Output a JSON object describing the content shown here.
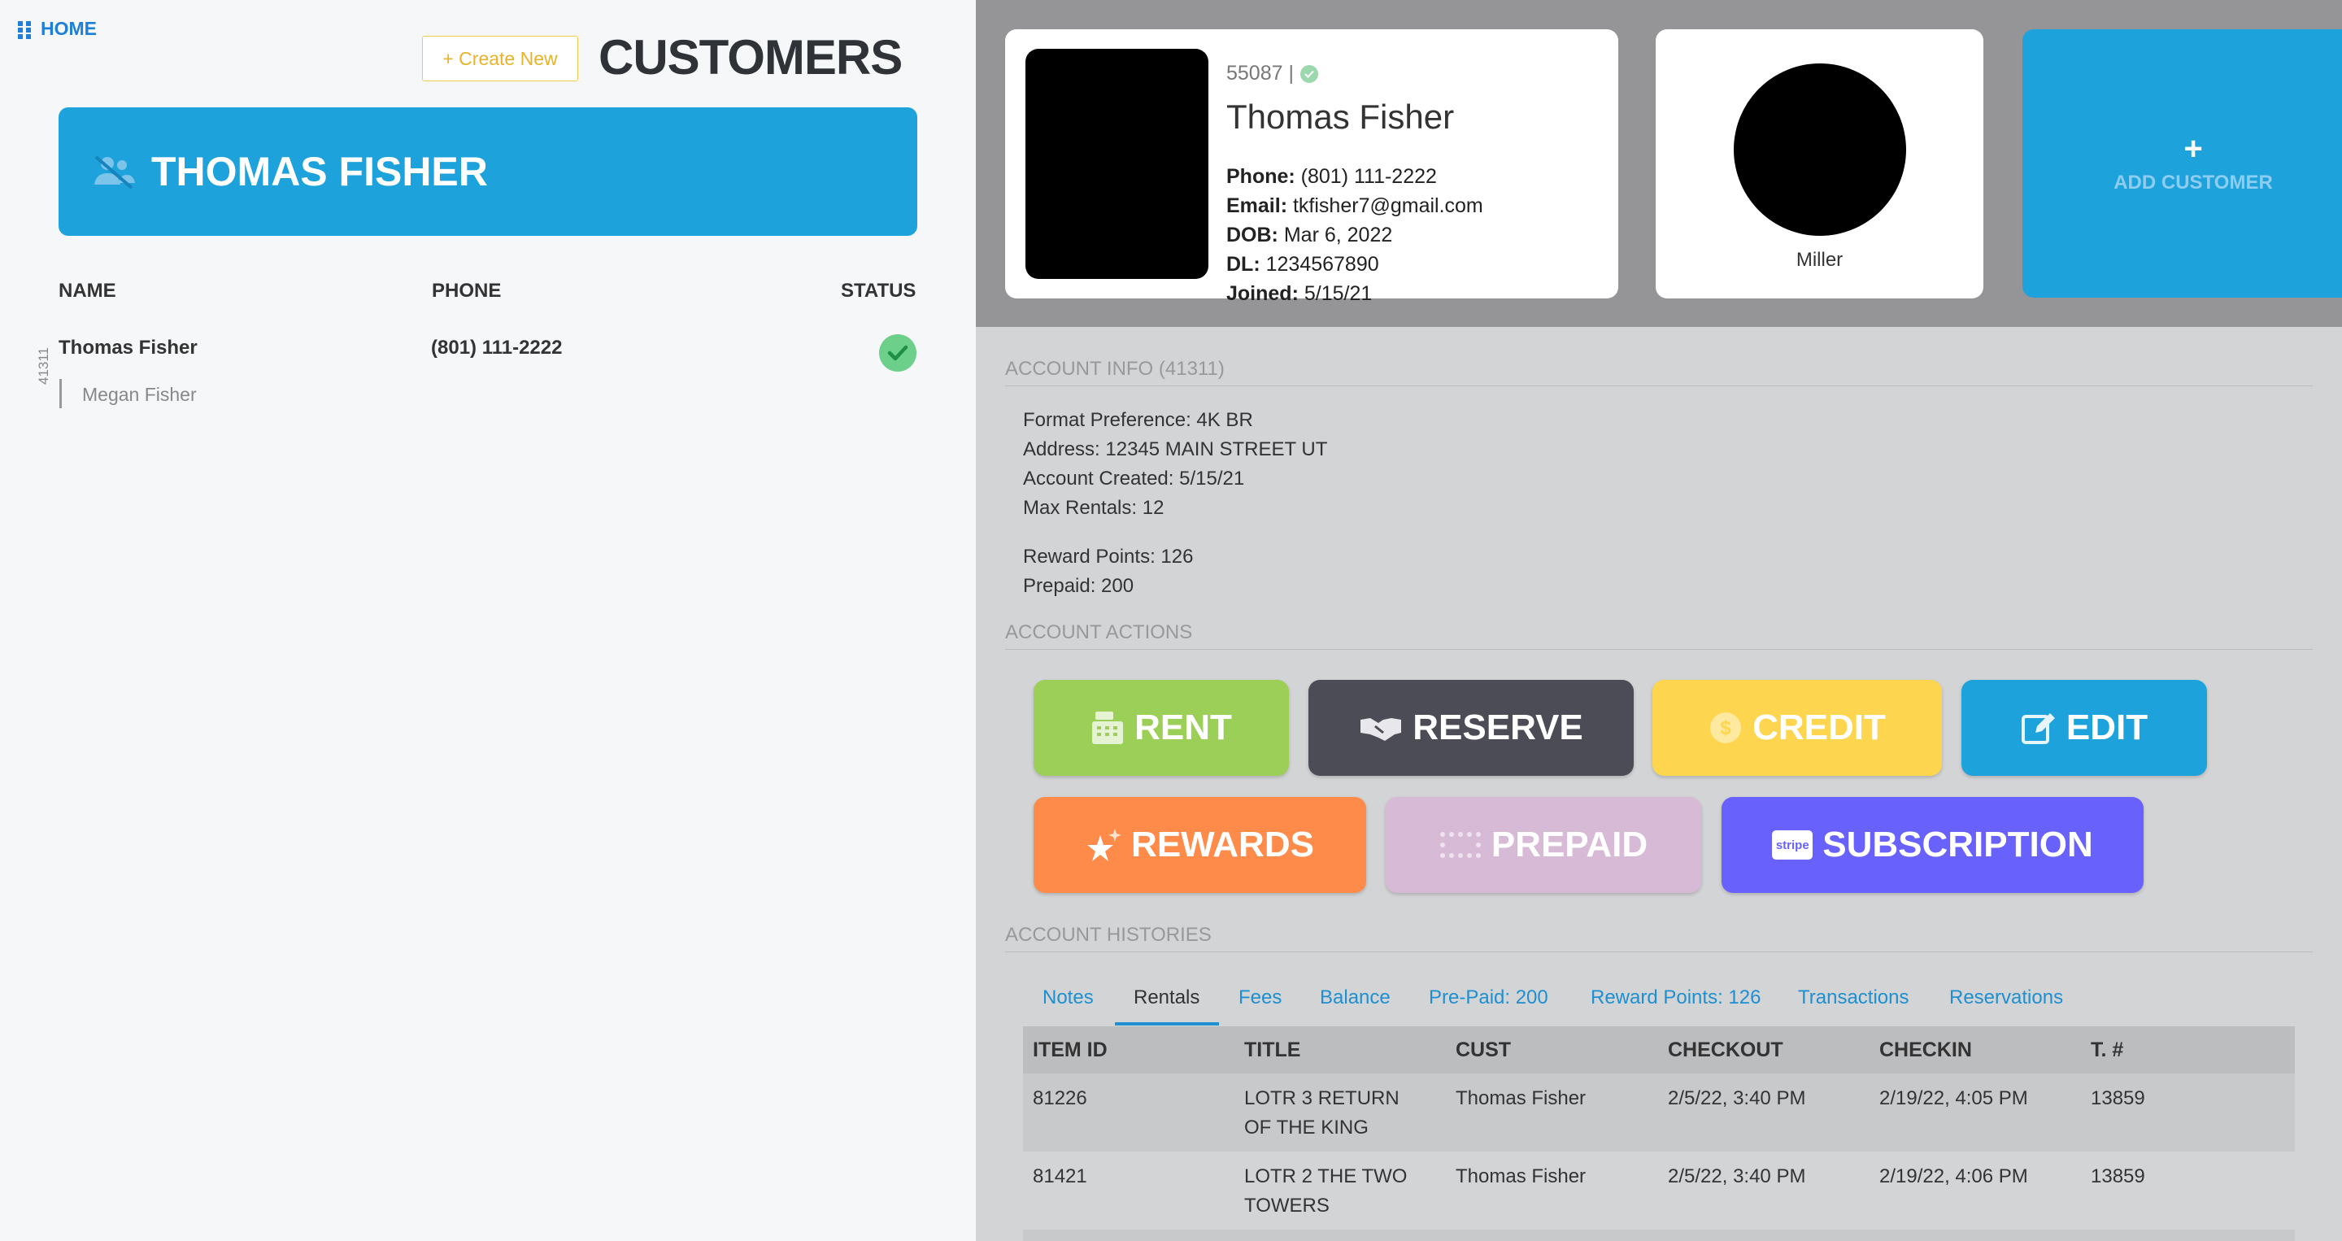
{
  "nav": {
    "home_label": "HOME"
  },
  "header": {
    "create_label": "+ Create New",
    "title": "CUSTOMERS"
  },
  "selected": {
    "banner_name": "THOMAS FISHER"
  },
  "table": {
    "columns": [
      "NAME",
      "PHONE",
      "STATUS"
    ],
    "rows": [
      {
        "name": "Thomas Fisher",
        "phone": "(801) 111-2222",
        "status": "active",
        "account": "41311",
        "members": [
          "Megan Fisher"
        ]
      }
    ]
  },
  "profile": {
    "id": "55087 |",
    "name": "Thomas Fisher",
    "phone_label": "Phone:",
    "phone": "(801) 111-2222",
    "email_label": "Email:",
    "email": "tkfisher7@gmail.com",
    "dob_label": "DOB:",
    "dob": "Mar 6, 2022",
    "dl_label": "DL:",
    "dl": "1234567890",
    "joined_label": "Joined:",
    "joined": "5/15/21"
  },
  "secondary": {
    "name": "Miller"
  },
  "add_customer": {
    "plus": "+",
    "label": "ADD CUSTOMER"
  },
  "account_info": {
    "title": "ACCOUNT INFO (41311)",
    "format": "Format Preference: 4K BR",
    "address": "Address: 12345 MAIN STREET UT",
    "created": "Account Created: 5/15/21",
    "max_rentals": "Max Rentals: 12",
    "reward_points": "Reward Points: 126",
    "prepaid": "Prepaid: 200"
  },
  "account_actions": {
    "title": "ACCOUNT ACTIONS",
    "rent": "RENT",
    "reserve": "RESERVE",
    "credit": "CREDIT",
    "edit": "EDIT",
    "rewards": "REWARDS",
    "prepaid": "PREPAID",
    "subscription": "SUBSCRIPTION",
    "stripe_badge": "stripe"
  },
  "histories": {
    "title": "ACCOUNT HISTORIES",
    "tabs": [
      "Notes",
      "Rentals",
      "Fees",
      "Balance",
      "Pre-Paid: 200",
      "Reward Points: 126",
      "Transactions",
      "Reservations"
    ],
    "active_tab": "Rentals",
    "columns": [
      "ITEM ID",
      "TITLE",
      "CUST",
      "CHECKOUT",
      "CHECKIN",
      "T. #"
    ],
    "rows": [
      {
        "item_id": "81226",
        "title": "LOTR 3 RETURN OF THE KING",
        "cust": "Thomas Fisher",
        "checkout": "2/5/22, 3:40 PM",
        "checkin": "2/19/22, 4:05 PM",
        "t": "13859"
      },
      {
        "item_id": "81421",
        "title": "LOTR 2 THE TWO TOWERS",
        "cust": "Thomas Fisher",
        "checkout": "2/5/22, 3:40 PM",
        "checkin": "2/19/22, 4:06 PM",
        "t": "13859"
      }
    ]
  },
  "colors": {
    "accent": "#1ea2dc",
    "rent": "#9ccf57",
    "reserve": "#4b4c56",
    "credit": "#fdd54e",
    "edit": "#1ea2dc",
    "rewards": "#fe8b49",
    "prepaid": "#d7bad6",
    "subscription": "#6861fc"
  },
  "icons": {
    "home": "grid-icon",
    "banner": "users-slash-icon",
    "status": "check-circle-icon",
    "rent": "cash-register-icon",
    "reserve": "handshake-icon",
    "credit": "dollar-coin-icon",
    "edit": "pencil-square-icon",
    "rewards": "star-sparkle-icon",
    "prepaid": "dots-grid-icon",
    "subscription": "stripe-icon"
  }
}
